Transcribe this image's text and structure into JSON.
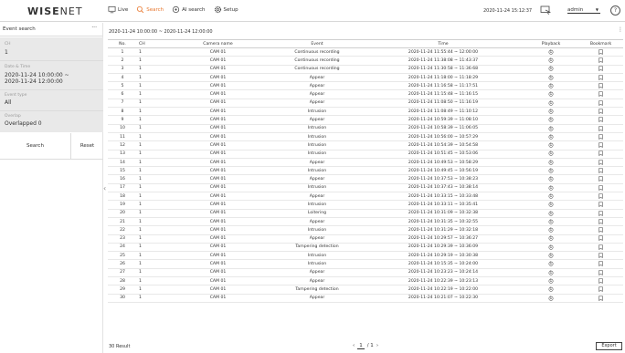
{
  "header": {
    "logo_bold": "WISE",
    "logo_thin": "NET",
    "nav": [
      {
        "label": "Live",
        "active": false,
        "icon": "monitor-icon"
      },
      {
        "label": "Search",
        "active": true,
        "icon": "search-icon"
      },
      {
        "label": "AI search",
        "active": false,
        "icon": "ai-search-icon"
      },
      {
        "label": "Setup",
        "active": false,
        "icon": "gear-icon"
      }
    ],
    "datetime": "2020-11-24 15:12:37",
    "user": "admin",
    "help": "?"
  },
  "sidebar": {
    "title": "Event search",
    "more": "···",
    "filters": {
      "ch_label": "CH",
      "ch_value": "1",
      "datetime_label": "Date & Time",
      "datetime_value_1": "2020-11-24 10:00:00 ~",
      "datetime_value_2": "2020-11-24 12:00:00",
      "event_type_label": "Event type",
      "event_type_value": "All",
      "overlap_label": "Overlap",
      "overlap_value": "Overlapped 0"
    },
    "search_label": "Search",
    "reset_label": "Reset",
    "collapse": "‹"
  },
  "results": {
    "range": "2020-11-24 10:00:00 ~ 2020-11-24 12:00:00",
    "kebab": "⋮",
    "columns": [
      "No.",
      "CH",
      "Camera name",
      "Event",
      "Time",
      "Playback",
      "Bookmark"
    ],
    "rows": [
      [
        "1",
        "1",
        "CAM 01",
        "Continuous recording",
        "2020-11-24 11:55:44 ~ 12:00:00"
      ],
      [
        "2",
        "1",
        "CAM 01",
        "Continuous recording",
        "2020-11-24 11:38:08 ~ 11:43:37"
      ],
      [
        "3",
        "1",
        "CAM 01",
        "Continuous recording",
        "2020-11-24 11:30:58 ~ 11:36:68"
      ],
      [
        "4",
        "1",
        "CAM 01",
        "Appear",
        "2020-11-24 11:18:00 ~ 11:18:29"
      ],
      [
        "5",
        "1",
        "CAM 01",
        "Appear",
        "2020-11-24 11:16:58 ~ 11:17:51"
      ],
      [
        "6",
        "1",
        "CAM 01",
        "Appear",
        "2020-11-24 11:15:48 ~ 11:16:15"
      ],
      [
        "7",
        "1",
        "CAM 01",
        "Appear",
        "2020-11-24 11:08:50 ~ 11:16:19"
      ],
      [
        "8",
        "1",
        "CAM 01",
        "Intrusion",
        "2020-11-24 11:08:49 ~ 11:10:12"
      ],
      [
        "9",
        "1",
        "CAM 01",
        "Appear",
        "2020-11-24 10:59:39 ~ 11:08:10"
      ],
      [
        "10",
        "1",
        "CAM 01",
        "Intrusion",
        "2020-11-24 10:58:39 ~ 11:06:05"
      ],
      [
        "11",
        "1",
        "CAM 01",
        "Intrusion",
        "2020-11-24 10:56:00 ~ 10:57:29"
      ],
      [
        "12",
        "1",
        "CAM 01",
        "Intrusion",
        "2020-11-24 10:54:39 ~ 10:54:58"
      ],
      [
        "13",
        "1",
        "CAM 01",
        "Intrusion",
        "2020-11-24 10:51:45 ~ 10:53:06"
      ],
      [
        "14",
        "1",
        "CAM 01",
        "Appear",
        "2020-11-24 10:49:53 ~ 10:58:29"
      ],
      [
        "15",
        "1",
        "CAM 01",
        "Intrusion",
        "2020-11-24 10:49:45 ~ 10:56:19"
      ],
      [
        "16",
        "1",
        "CAM 01",
        "Appear",
        "2020-11-24 10:37:53 ~ 10:38:23"
      ],
      [
        "17",
        "1",
        "CAM 01",
        "Intrusion",
        "2020-11-24 10:37:43 ~ 10:38:14"
      ],
      [
        "18",
        "1",
        "CAM 01",
        "Appear",
        "2020-11-24 10:33:15 ~ 10:33:48"
      ],
      [
        "19",
        "1",
        "CAM 01",
        "Intrusion",
        "2020-11-24 10:33:11 ~ 10:35:41"
      ],
      [
        "20",
        "1",
        "CAM 01",
        "Loitering",
        "2020-11-24 10:31:09 ~ 10:32:38"
      ],
      [
        "21",
        "1",
        "CAM 01",
        "Appear",
        "2020-11-24 10:31:35 ~ 10:32:55"
      ],
      [
        "22",
        "1",
        "CAM 01",
        "Intrusion",
        "2020-11-24 10:31:29 ~ 10:32:18"
      ],
      [
        "23",
        "1",
        "CAM 01",
        "Appear",
        "2020-11-24 10:29:57 ~ 10:36:27"
      ],
      [
        "24",
        "1",
        "CAM 01",
        "Tampering detection",
        "2020-11-24 10:29:39 ~ 10:36:09"
      ],
      [
        "25",
        "1",
        "CAM 01",
        "Intrusion",
        "2020-11-24 10:29:19 ~ 10:30:38"
      ],
      [
        "26",
        "1",
        "CAM 01",
        "Intrusion",
        "2020-11-24 10:15:35 ~ 10:24:00"
      ],
      [
        "27",
        "1",
        "CAM 01",
        "Appear",
        "2020-11-24 10:23:23 ~ 10:24:14"
      ],
      [
        "28",
        "1",
        "CAM 01",
        "Appear",
        "2020-11-24 10:22:39 ~ 10:23:13"
      ],
      [
        "29",
        "1",
        "CAM 01",
        "Tampering detection",
        "2020-11-24 10:22:19 ~ 10:22:00"
      ],
      [
        "30",
        "1",
        "CAM 01",
        "Appear",
        "2020-11-24 10:21:07 ~ 10:22:30"
      ]
    ],
    "result_count": "30 Result",
    "pager_prev": "‹",
    "pager_current": "1",
    "pager_total": "/ 1",
    "pager_next": "›",
    "export_label": "Export"
  }
}
